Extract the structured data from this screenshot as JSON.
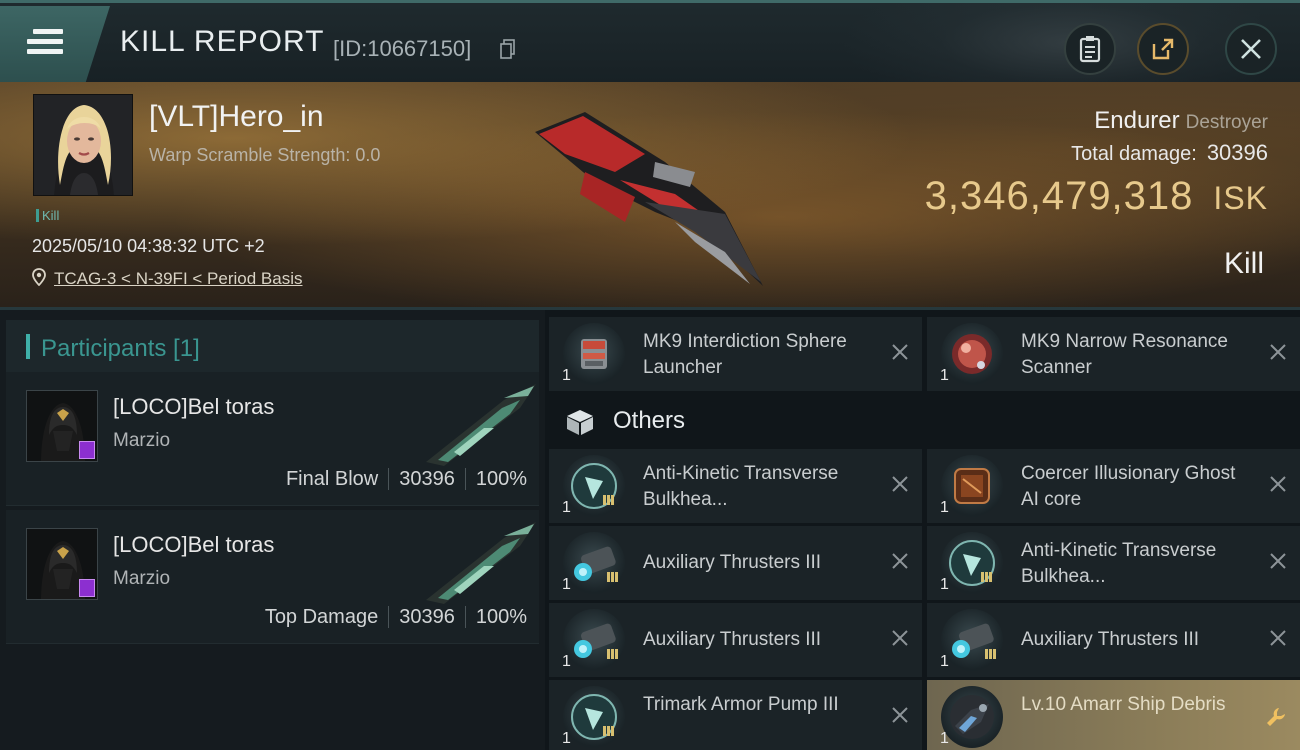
{
  "header": {
    "title": "KILL REPORT",
    "report_id": "[ID:10667150]"
  },
  "victim": {
    "name": "[VLT]Hero_in",
    "warp_scramble": "Warp Scramble Strength: 0.0",
    "tag": "Kill",
    "datetime": "2025/05/10 04:38:32 UTC +2",
    "location": "TCAG-3 < N-39FI < Period Basis",
    "ship_name": "Endurer",
    "ship_class": "Destroyer",
    "total_damage_label": "Total damage:",
    "total_damage": "30396",
    "isk_value": "3,346,479,318",
    "isk_unit": "ISK",
    "result": "Kill"
  },
  "participants": {
    "header": "Participants [1]",
    "rows": [
      {
        "name": "[LOCO]Bel toras",
        "ship": "Marzio",
        "role": "Final Blow",
        "damage": "30396",
        "percent": "100%"
      },
      {
        "name": "[LOCO]Bel toras",
        "ship": "Marzio",
        "role": "Top Damage",
        "damage": "30396",
        "percent": "100%"
      }
    ]
  },
  "modules": {
    "top": [
      {
        "name": "MK9 Interdiction Sphere Launcher",
        "qty": "1",
        "icon": "launcher-icon"
      },
      {
        "name": "MK9 Narrow Resonance Scanner",
        "qty": "1",
        "icon": "scanner-icon"
      }
    ],
    "others_label": "Others",
    "others": [
      {
        "name": "Anti-Kinetic Transverse Bulkhea...",
        "qty": "1",
        "icon": "rig-icon"
      },
      {
        "name": "Coercer Illusionary Ghost AI core",
        "qty": "1",
        "icon": "ai-core-icon"
      },
      {
        "name": "Auxiliary Thrusters III",
        "qty": "1",
        "icon": "thruster-icon"
      },
      {
        "name": "Anti-Kinetic Transverse Bulkhea...",
        "qty": "1",
        "icon": "rig-icon"
      },
      {
        "name": "Auxiliary Thrusters III",
        "qty": "1",
        "icon": "thruster-icon"
      },
      {
        "name": "Auxiliary Thrusters III",
        "qty": "1",
        "icon": "thruster-icon"
      },
      {
        "name": "Trimark Armor Pump III",
        "qty": "1",
        "icon": "rig-icon"
      },
      {
        "name": "Lv.10 Amarr Ship Debris",
        "qty": "1",
        "icon": "debris-icon"
      }
    ]
  },
  "colors": {
    "accent_teal": "#3fb0a9",
    "isk_gold": "#e7c98c",
    "highlight_gold": "#8a7c58"
  }
}
